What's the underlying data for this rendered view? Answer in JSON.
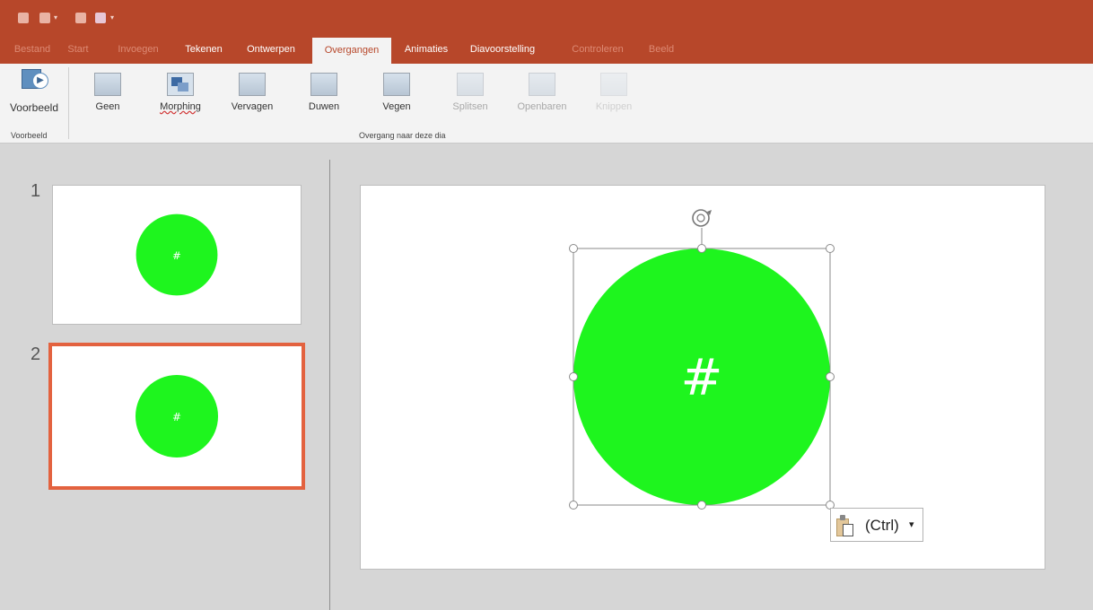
{
  "tabs": [
    {
      "label": "Bestand",
      "state": "dim"
    },
    {
      "label": "Start",
      "state": "dim"
    },
    {
      "label": "Invoegen",
      "state": "dim"
    },
    {
      "label": "Tekenen",
      "state": "normal"
    },
    {
      "label": "Ontwerpen",
      "state": "normal"
    },
    {
      "label": "Overgangen",
      "state": "active"
    },
    {
      "label": "Animaties",
      "state": "normal"
    },
    {
      "label": "Diavoorstelling",
      "state": "normal"
    },
    {
      "label": "Controleren",
      "state": "dim"
    },
    {
      "label": "Beeld",
      "state": "dim"
    }
  ],
  "ribbon": {
    "preview_label": "Voorbeeld",
    "preview_group": "Voorbeeld",
    "transitions_group": "Overgang naar deze dia",
    "transitions": [
      {
        "label": "Geen",
        "enabled": true
      },
      {
        "label": "Morphing",
        "enabled": true
      },
      {
        "label": "Vervagen",
        "enabled": true
      },
      {
        "label": "Duwen",
        "enabled": true
      },
      {
        "label": "Vegen",
        "enabled": true
      },
      {
        "label": "Splitsen",
        "enabled": false
      },
      {
        "label": "Openbaren",
        "enabled": false
      },
      {
        "label": "Knippen",
        "enabled": false
      }
    ]
  },
  "slides": [
    {
      "number": "1",
      "shape_text": "#",
      "selected": false
    },
    {
      "number": "2",
      "shape_text": "#",
      "selected": true
    }
  ],
  "canvas": {
    "shape_text": "#",
    "shape_color": "#1ef51e"
  },
  "paste": {
    "label": "(Ctrl)",
    "caret": "▾"
  },
  "colors": {
    "accent": "#b7472a",
    "selection": "#e3623f"
  }
}
